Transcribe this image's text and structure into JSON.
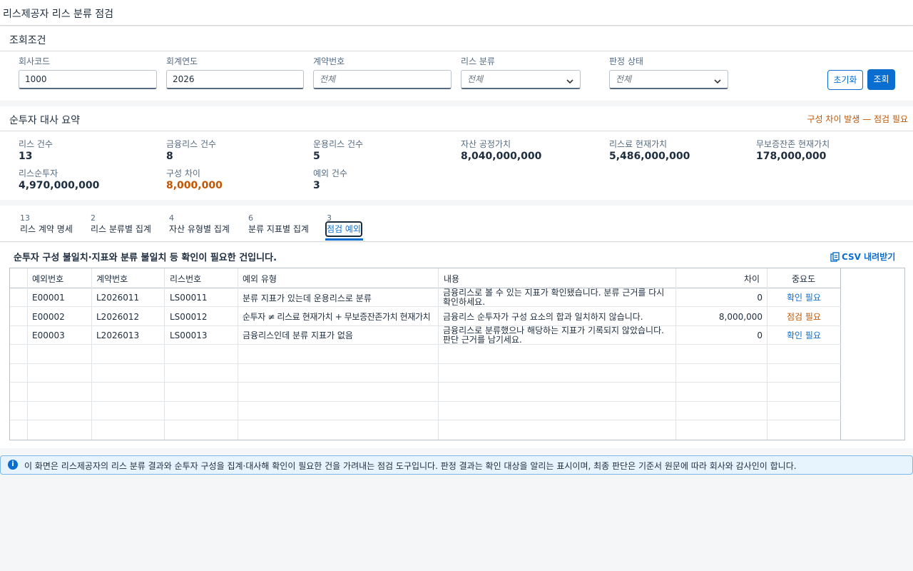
{
  "page_title": "리스제공자 리스 분류 점검",
  "filters": {
    "title": "조회조건",
    "company_code": {
      "label": "회사코드",
      "value": "1000"
    },
    "fiscal_year": {
      "label": "회계연도",
      "value": "2026"
    },
    "contract_no": {
      "label": "계약번호",
      "placeholder": "전체"
    },
    "lease_class": {
      "label": "리스 분류",
      "placeholder": "전체"
    },
    "judgment_status": {
      "label": "판정 상태",
      "placeholder": "전체"
    },
    "reset_label": "초기화",
    "search_label": "조회"
  },
  "summary": {
    "title": "순투자 대사 요약",
    "warning": "구성 차이 발생 — 점검 필요",
    "kpis": [
      {
        "label": "리스 건수",
        "value": "13"
      },
      {
        "label": "금융리스 건수",
        "value": "8"
      },
      {
        "label": "운용리스 건수",
        "value": "5"
      },
      {
        "label": "자산 공정가치",
        "value": "8,040,000,000"
      },
      {
        "label": "리스료 현재가치",
        "value": "5,486,000,000"
      },
      {
        "label": "무보증잔존 현재가치",
        "value": "178,000,000"
      },
      {
        "label": "리스순투자",
        "value": "4,970,000,000"
      },
      {
        "label": "구성 차이",
        "value": "8,000,000"
      },
      {
        "label": "예외 건수",
        "value": "3"
      }
    ]
  },
  "tabs": [
    {
      "count": "13",
      "label": "리스 계약 명세"
    },
    {
      "count": "2",
      "label": "리스 분류별 집계"
    },
    {
      "count": "4",
      "label": "자산 유형별 집계"
    },
    {
      "count": "6",
      "label": "분류 지표별 집계"
    },
    {
      "count": "3",
      "label": "점검 예외"
    }
  ],
  "exceptions": {
    "title": "순투자 구성 불일치·지표와 분류 불일치 등 확인이 필요한 건입니다.",
    "csv_label": "CSV 내려받기",
    "columns": [
      "예외번호",
      "계약번호",
      "리스번호",
      "예외 유형",
      "내용",
      "차이",
      "중요도"
    ],
    "rows": [
      {
        "id": "E00001",
        "contract": "L2026011",
        "lease": "LS00011",
        "type": "분류 지표가 있는데 운용리스로 분류",
        "content": "금융리스로 볼 수 있는 지표가 확인됐습니다. 분류 근거를 다시 확인하세요.",
        "diff": "0",
        "severity": "확인 필요"
      },
      {
        "id": "E00002",
        "contract": "L2026012",
        "lease": "LS00012",
        "type": "순투자 ≠ 리스료 현재가치 + 무보증잔존가치 현재가치",
        "content": "금융리스 순투자가 구성 요소의 합과 일치하지 않습니다.",
        "diff": "8,000,000",
        "severity": "점검 필요"
      },
      {
        "id": "E00003",
        "contract": "L2026013",
        "lease": "LS00013",
        "type": "금융리스인데 분류 지표가 없음",
        "content": "금융리스로 분류했으나 해당하는 지표가 기록되지 않았습니다. 판단 근거를 남기세요.",
        "diff": "0",
        "severity": "확인 필요"
      }
    ]
  },
  "info_text": "이 화면은 리스제공자의 리스 분류 결과와 순투자 구성을 집계·대사해 확인이 필요한 건을 가려내는 점검 도구입니다. 판정 결과는 확인 대상을 알리는 표시이며, 최종 판단은 기준서 원문에 따라 회사와 감사인이 합니다.",
  "colors": {
    "accent": "#0a6ed1",
    "warning": "#c35500"
  }
}
